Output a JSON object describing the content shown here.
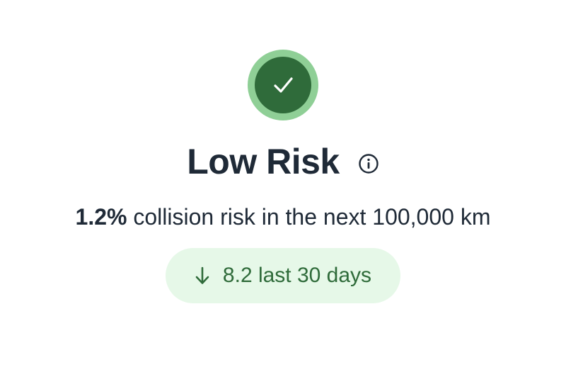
{
  "status": {
    "icon": "checkmark-icon",
    "colors": {
      "ring": "#8fcf96",
      "circle": "#2f6b3a",
      "check": "#ffffff"
    }
  },
  "risk": {
    "level_label": "Low Risk",
    "info_icon": "info-icon",
    "percentage": "1.2%",
    "description": "collision risk in the next 100,000 km"
  },
  "trend": {
    "direction_icon": "arrow-down-icon",
    "text": "8.2 last 30 days",
    "colors": {
      "background": "#e6f8e8",
      "text": "#2f6b3a"
    }
  },
  "colors": {
    "text_primary": "#1f2a37"
  }
}
